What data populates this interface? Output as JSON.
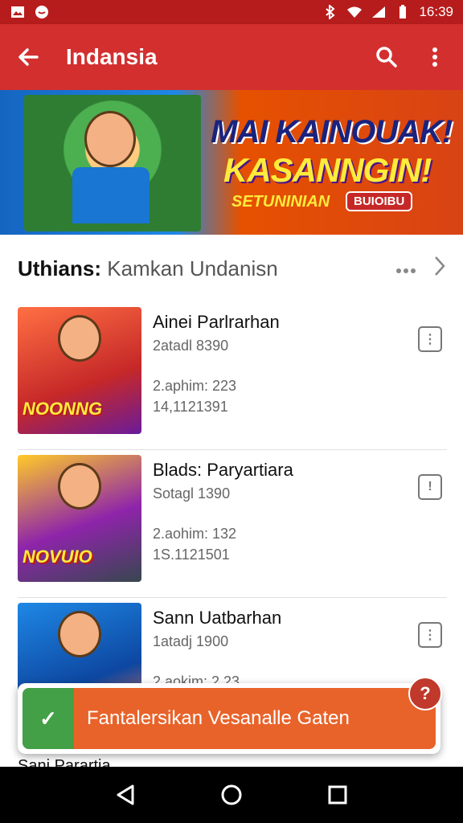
{
  "status_bar": {
    "time": "16:39",
    "icons": [
      "image-icon",
      "chat-bubble-icon",
      "bluetooth-icon",
      "wifi-icon",
      "signal-icon",
      "battery-icon"
    ]
  },
  "app_bar": {
    "title": "Indansia",
    "icons": [
      "back-arrow-icon",
      "search-icon",
      "overflow-menu-icon"
    ]
  },
  "banner": {
    "line1": "MAI KAINOUAK!",
    "line2": "KASANNGIN!",
    "line3": "SETUNINIAN",
    "badge": "BUIOIBU"
  },
  "section": {
    "label": "Uthians:",
    "sublabel": "Kamkan Undanisn"
  },
  "items": [
    {
      "name": "Ainei Parlrarhan",
      "meta1": "2atadl 8390",
      "meta2": "2.aphim: 223",
      "meta3": "14,1121391",
      "thumb_caption": "NOONNG"
    },
    {
      "name": "Blads: Paryartiara",
      "meta1": "Sotagl 1390",
      "meta2": "2.aohim: 132",
      "meta3": "1S.1121501",
      "thumb_caption": "NOVUIO"
    },
    {
      "name": "Sann Uatbarhan",
      "meta1": "1atadj 1900",
      "meta2": "2.aokim: 2.23",
      "meta3": "",
      "thumb_caption": ""
    }
  ],
  "peek_item": "Sani Parartia",
  "snackbar": {
    "message": "Fantalersikan Vesanalle Gaten",
    "help": "?"
  },
  "colors": {
    "primary": "#d32f2f",
    "status": "#b71c1c",
    "snackbar": "#e8632a",
    "check": "#43a047"
  }
}
